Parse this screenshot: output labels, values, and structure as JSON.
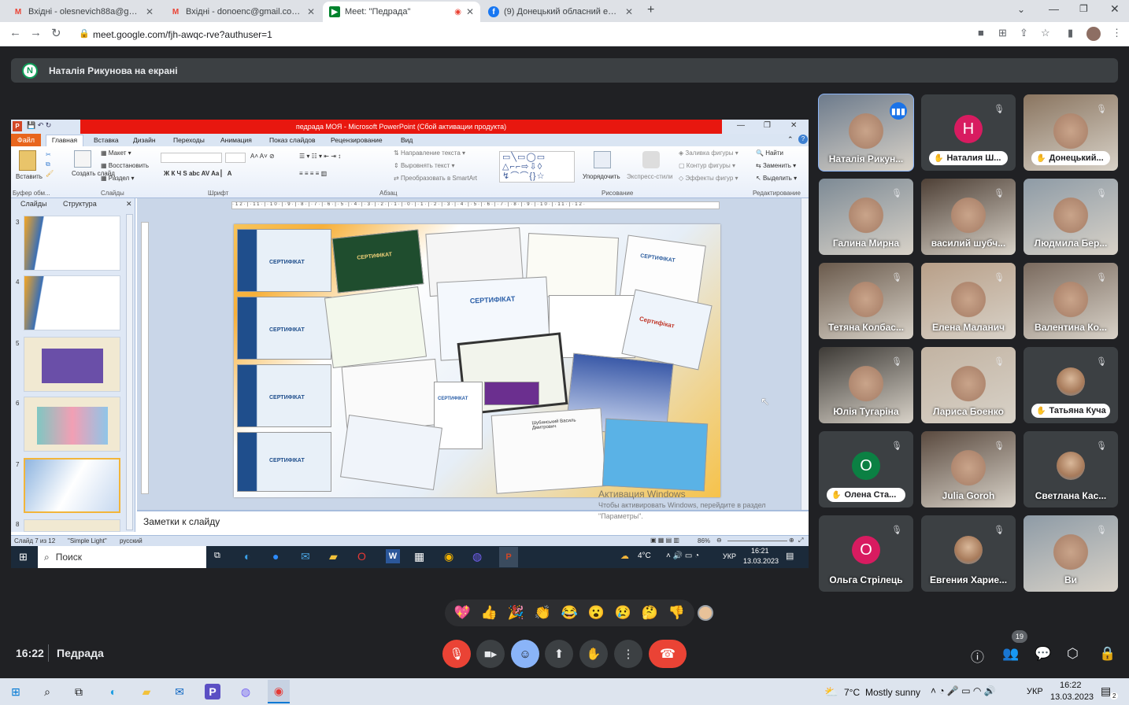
{
  "browser": {
    "tabs": [
      {
        "title": "Вхідні - olesnevich88a@gmail.co",
        "favicon": "gmail-icon",
        "active": false
      },
      {
        "title": "Вхідні - donoenc@gmail.com - G",
        "favicon": "gmail-icon",
        "active": false
      },
      {
        "title": "Meet: \"Педрада\"",
        "favicon": "meet-icon",
        "active": true
      },
      {
        "title": "(9) Донецький обласний еколо",
        "favicon": "facebook-icon",
        "active": false
      }
    ],
    "url": "meet.google.com/fjh-awqc-rve?authuser=1"
  },
  "meet": {
    "presenting_badge": "N",
    "presenting_text": "Наталія Рикунова на екрані",
    "time": "16:22",
    "title": "Педрада",
    "participant_count": "19",
    "accent_color": "#8ab4f8",
    "hangup_color": "#ea4335",
    "participants": [
      {
        "name": "Наталія Рикун...",
        "type": "video",
        "speaking": true
      },
      {
        "name": "Наталия Ш...",
        "type": "avatar",
        "initial": "Н",
        "color": "#d81b60",
        "hand": true
      },
      {
        "name": "Донецький...",
        "type": "video",
        "hand": true
      },
      {
        "name": "Галина Мирна",
        "type": "video"
      },
      {
        "name": "василий шубч...",
        "type": "video"
      },
      {
        "name": "Людмила Бер...",
        "type": "video"
      },
      {
        "name": "Тетяна Колбас...",
        "type": "video"
      },
      {
        "name": "Елена Маланич",
        "type": "video"
      },
      {
        "name": "Валентина Ко...",
        "type": "video"
      },
      {
        "name": "Юлія Тугаріна",
        "type": "video"
      },
      {
        "name": "Лариса Боенко",
        "type": "video"
      },
      {
        "name": "Татьяна Куча",
        "type": "photo",
        "hand": true
      },
      {
        "name": "Олена Ста...",
        "type": "avatar",
        "initial": "О",
        "color": "#0b8043",
        "hand": true
      },
      {
        "name": "Julia Goroh",
        "type": "video"
      },
      {
        "name": "Светлана Кас...",
        "type": "photo"
      },
      {
        "name": "Ольга Стрілець",
        "type": "avatar",
        "initial": "О",
        "color": "#d81b60"
      },
      {
        "name": "Евгения Харие...",
        "type": "photo"
      },
      {
        "name": "Ви",
        "type": "video"
      }
    ],
    "reactions": [
      "💖",
      "👍",
      "🎉",
      "👏",
      "😂",
      "😮",
      "😢",
      "🤔",
      "👎"
    ]
  },
  "powerpoint": {
    "title": "педрада МОЯ - Microsoft PowerPoint (Сбой активации продукта)",
    "tabs": [
      "Файл",
      "Главная",
      "Вставка",
      "Дизайн",
      "Переходы",
      "Анимация",
      "Показ слайдов",
      "Рецензирование",
      "Вид"
    ],
    "groups": [
      "Буфер обм...",
      "Слайды",
      "Шрифт",
      "Абзац",
      "Рисование",
      "Редактирование"
    ],
    "buttons": {
      "paste": "Вставить",
      "create_slide": "Создать слайд",
      "layout": "Макет",
      "restore": "Восстановить",
      "section": "Раздел",
      "text_direction": "Направление текста",
      "align_text": "Выровнять текст",
      "smartart": "Преобразовать в SmartArt",
      "arrange": "Упорядочить",
      "quick_styles": "Экспресс-стили",
      "shape_fill": "Заливка фигуры",
      "shape_outline": "Контур фигуры",
      "shape_effects": "Эффекты фигур",
      "find": "Найти",
      "replace": "Заменить",
      "select": "Выделить"
    },
    "panel_tabs": [
      "Слайды",
      "Структура"
    ],
    "slide_numbers": [
      "3",
      "4",
      "5",
      "6",
      "7",
      "8"
    ],
    "cert_label": "СЕРТИФІКАТ",
    "cert_label_ru": "Сертифікат",
    "cert_name": "Шубинський Василь Дмитрович",
    "notes_placeholder": "Заметки к слайду",
    "watermark_1": "Активация Windows",
    "watermark_2": "Чтобы активировать Windows, перейдите в раздел \"Параметры\".",
    "status_slide": "Слайд 7 из 12",
    "status_theme": "\"Simple Light\"",
    "status_lang": "русский",
    "zoom": "86%",
    "ruler": "·12·|·11·|·10·|·9·|·8·|·7·|·6·|·5·|·4·|·3·|·2·|·1·|·0·|·1·|·2·|·3·|·4·|·5·|·6·|·7·|·8·|·9·|·10·|·11·|·12·"
  },
  "inner_taskbar": {
    "search": "Поиск",
    "weather": "4°C",
    "lang": "УКР",
    "time": "16:21",
    "date": "13.03.2023"
  },
  "taskbar": {
    "weather": "7°C",
    "weather_text": "Mostly sunny",
    "lang": "УКР",
    "time": "16:22",
    "date": "13.03.2023",
    "notifications": "2"
  }
}
